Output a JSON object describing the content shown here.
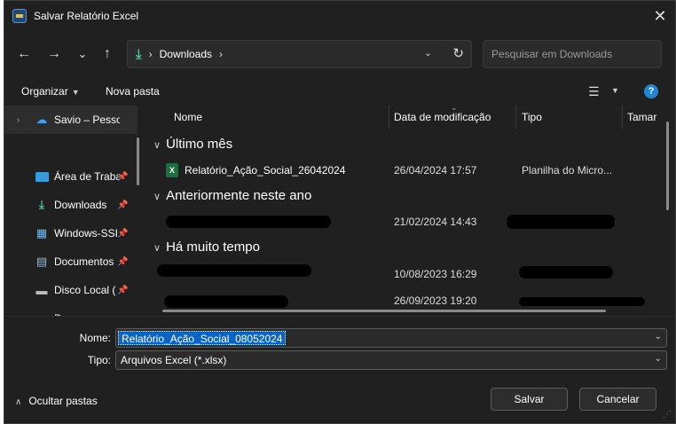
{
  "window": {
    "title": "Salvar Relatório Excel",
    "close": "✕"
  },
  "nav": {
    "back": "←",
    "forward": "→",
    "recent": "⌄",
    "up": "↑",
    "path_icon": "download-icon",
    "crumb_sep": "›",
    "crumb": "Downloads",
    "search_placeholder": "Pesquisar em Downloads"
  },
  "toolbar": {
    "organize": "Organizar",
    "new_folder": "Nova pasta",
    "help": "?"
  },
  "sidebar": {
    "items": [
      {
        "label": "Savio – Pessoal",
        "icon": "cloud-icon",
        "pinned": false
      },
      {
        "label": "Área de Traba",
        "icon": "desktop-icon",
        "pinned": true
      },
      {
        "label": "Downloads",
        "icon": "download-icon",
        "pinned": true
      },
      {
        "label": "Windows-SSI",
        "icon": "network-icon",
        "pinned": true
      },
      {
        "label": "Documentos",
        "icon": "document-icon",
        "pinned": true
      },
      {
        "label": "Disco Local (",
        "icon": "drive-icon",
        "pinned": true
      },
      {
        "label": "D",
        "icon": "folder-icon",
        "pinned": false
      }
    ]
  },
  "columns": {
    "name": "Nome",
    "date": "Data de modificação",
    "type": "Tipo",
    "size": "Tamar"
  },
  "groups": [
    {
      "label": "Último mês"
    },
    {
      "label": "Anteriormente neste ano"
    },
    {
      "label": "Há muito tempo"
    }
  ],
  "files": [
    {
      "name": "Relatório_Ação_Social_26042024",
      "date": "26/04/2024 17:57",
      "type": "Planilha do Micro..."
    },
    {
      "name": "",
      "date": "21/02/2024 14:43",
      "type": ""
    },
    {
      "name": "",
      "date": "10/08/2023 16:29",
      "type": ""
    },
    {
      "name": "",
      "date": "26/09/2023 19:20",
      "type": ""
    }
  ],
  "form": {
    "name_label": "Nome:",
    "name_value": "Relatório_Ação_Social_08052024",
    "type_label": "Tipo:",
    "type_value": "Arquivos Excel (*.xlsx)",
    "hide_folders": "Ocultar pastas",
    "save": "Salvar",
    "cancel": "Cancelar"
  },
  "colors": {
    "dialog_bg": "#202020",
    "accent": "#0a64c8",
    "excel_green": "#1d6f42",
    "downloads_teal": "#4ec1a3"
  }
}
